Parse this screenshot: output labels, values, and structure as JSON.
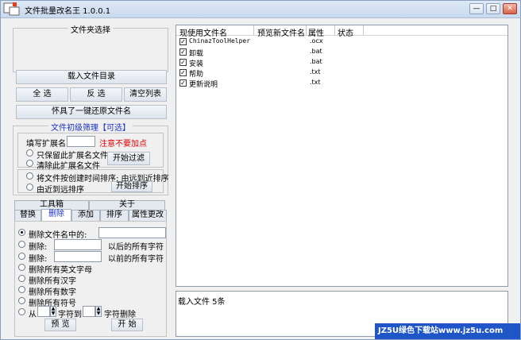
{
  "window": {
    "title": "文件批量改名王  1.0.0.1",
    "min": "—",
    "max": "□",
    "close": "✕"
  },
  "file_select": {
    "legend": "文件夹选择",
    "load_dir": "载入文件目录",
    "select_all": "全 选",
    "invert": "反 选",
    "clear": "清空列表",
    "restore": "怀具了一键还原文件名"
  },
  "filter": {
    "legend": "文件初级筛理【可选】",
    "ext_label": "填写扩展名:",
    "ext_note": "注意不要加点",
    "keep_ext": "只保留此扩展名文件",
    "remove_ext": "清除此扩展名文件",
    "start_filter": "开始过滤",
    "sort_far_to_near": "将文件按创建时间排序: 由远到近排序",
    "sort_near_to_far": "由近到远排序",
    "start_sort": "开始排序"
  },
  "tabs_top": {
    "toolbox": "工具箱",
    "about": "关于"
  },
  "tabs": [
    "替换",
    "删除",
    "添加",
    "排序",
    "属性更改"
  ],
  "delete_panel": {
    "opt1": "删除文件名中的:",
    "opt2": "删除:",
    "opt2_suffix": "以后的所有字符",
    "opt3": "删除:",
    "opt3_suffix": "以前的所有字符",
    "opt4": "删除所有英文字母",
    "opt5": "删除所有汉字",
    "opt6": "删除所有数字",
    "opt7": "删除所有符号",
    "opt8_from": "从",
    "opt8_to": "字符到",
    "opt8_suffix": "字符删除",
    "preview": "预 览",
    "start": "开 始"
  },
  "file_list": {
    "headers": [
      "现使用文件名",
      "预览新文件名",
      "属性",
      "状态"
    ],
    "rows": [
      {
        "name": "ChinazToolHelper",
        "attr": ".ocx"
      },
      {
        "name": "卸载",
        "attr": ".bat"
      },
      {
        "name": "安装",
        "attr": ".bat"
      },
      {
        "name": "帮助",
        "attr": ".txt"
      },
      {
        "name": "更新说明",
        "attr": ".txt"
      }
    ]
  },
  "log": {
    "text": "载入文件  5条"
  },
  "watermark": {
    "text": "JZ5U绿色下载站www.jz5u.com"
  },
  "colors": {
    "accent": "#1a32c8",
    "note": "#e00000",
    "title_bg": "#c9d9ee"
  }
}
